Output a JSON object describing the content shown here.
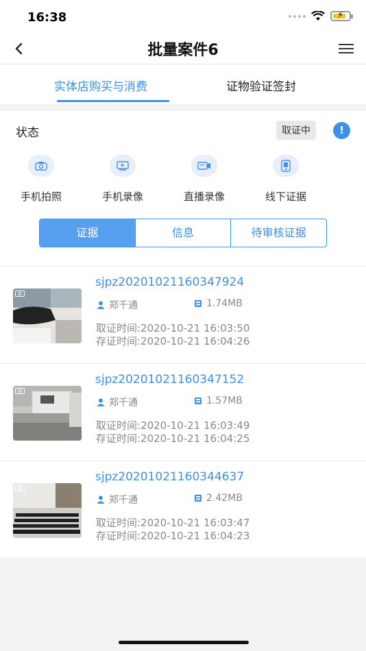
{
  "status_bar": {
    "time": "16:38"
  },
  "nav": {
    "title": "批量案件6"
  },
  "top_tabs": [
    {
      "label": "实体店购买与消费",
      "active": true
    },
    {
      "label": "证物验证签封",
      "active": false
    }
  ],
  "status": {
    "label": "状态",
    "badge": "取证中"
  },
  "actions": [
    {
      "label": "手机拍照",
      "icon": "camera-icon"
    },
    {
      "label": "手机录像",
      "icon": "video-icon"
    },
    {
      "label": "直播录像",
      "icon": "live-record-icon"
    },
    {
      "label": "线下证据",
      "icon": "offline-evidence-icon"
    }
  ],
  "segments": [
    {
      "label": "证据",
      "active": true
    },
    {
      "label": "信息",
      "active": false
    },
    {
      "label": "待审核证据",
      "active": false
    }
  ],
  "evidence_items": [
    {
      "id": "sjpz20201021160347924",
      "user": "郑千通",
      "size": "1.74MB",
      "capture_time": "取证时间:2020-10-21 16:03:50",
      "store_time": "存证时间:2020-10-21 16:04:26"
    },
    {
      "id": "sjpz20201021160347152",
      "user": "郑千通",
      "size": "1.57MB",
      "capture_time": "取证时间:2020-10-21 16:03:49",
      "store_time": "存证时间:2020-10-21 16:04:25"
    },
    {
      "id": "sjpz20201021160344637",
      "user": "郑千通",
      "size": "2.42MB",
      "capture_time": "取证时间:2020-10-21 16:03:47",
      "store_time": "存证时间:2020-10-21 16:04:23"
    }
  ],
  "colors": {
    "accent": "#3e8fe6",
    "accent_fill": "#57a0f0",
    "muted_text": "#888888"
  }
}
